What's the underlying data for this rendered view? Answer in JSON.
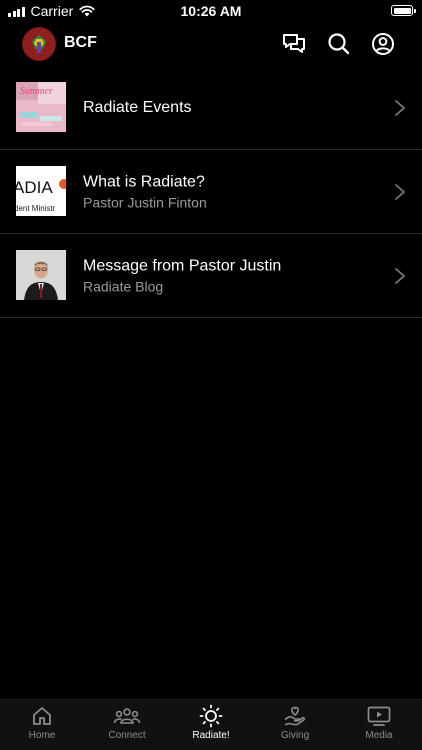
{
  "status_bar": {
    "carrier": "Carrier",
    "time": "10:26 AM"
  },
  "header": {
    "brand": "BCF",
    "icons": [
      "chat-icon",
      "search-icon",
      "account-icon"
    ]
  },
  "items": [
    {
      "title": "Radiate Events",
      "subtitle": "",
      "thumb_text": "Summer"
    },
    {
      "title": "What is Radiate?",
      "subtitle": "Pastor Justin Finton",
      "thumb_text_top": "ADIA",
      "thumb_text_bottom": "dent Ministr"
    },
    {
      "title": "Message from Pastor Justin",
      "subtitle": "Radiate Blog"
    }
  ],
  "tabs": [
    {
      "label": "Home",
      "icon": "home-icon",
      "active": false
    },
    {
      "label": "Connect",
      "icon": "people-icon",
      "active": false
    },
    {
      "label": "Radiate!",
      "icon": "sun-icon",
      "active": true
    },
    {
      "label": "Giving",
      "icon": "heart-hand-icon",
      "active": false
    },
    {
      "label": "Media",
      "icon": "play-screen-icon",
      "active": false
    }
  ],
  "colors": {
    "background": "#000000",
    "subtitle": "#9a9a9a",
    "tab_inactive": "#8c8c8c",
    "divider": "#2b2b2b"
  }
}
